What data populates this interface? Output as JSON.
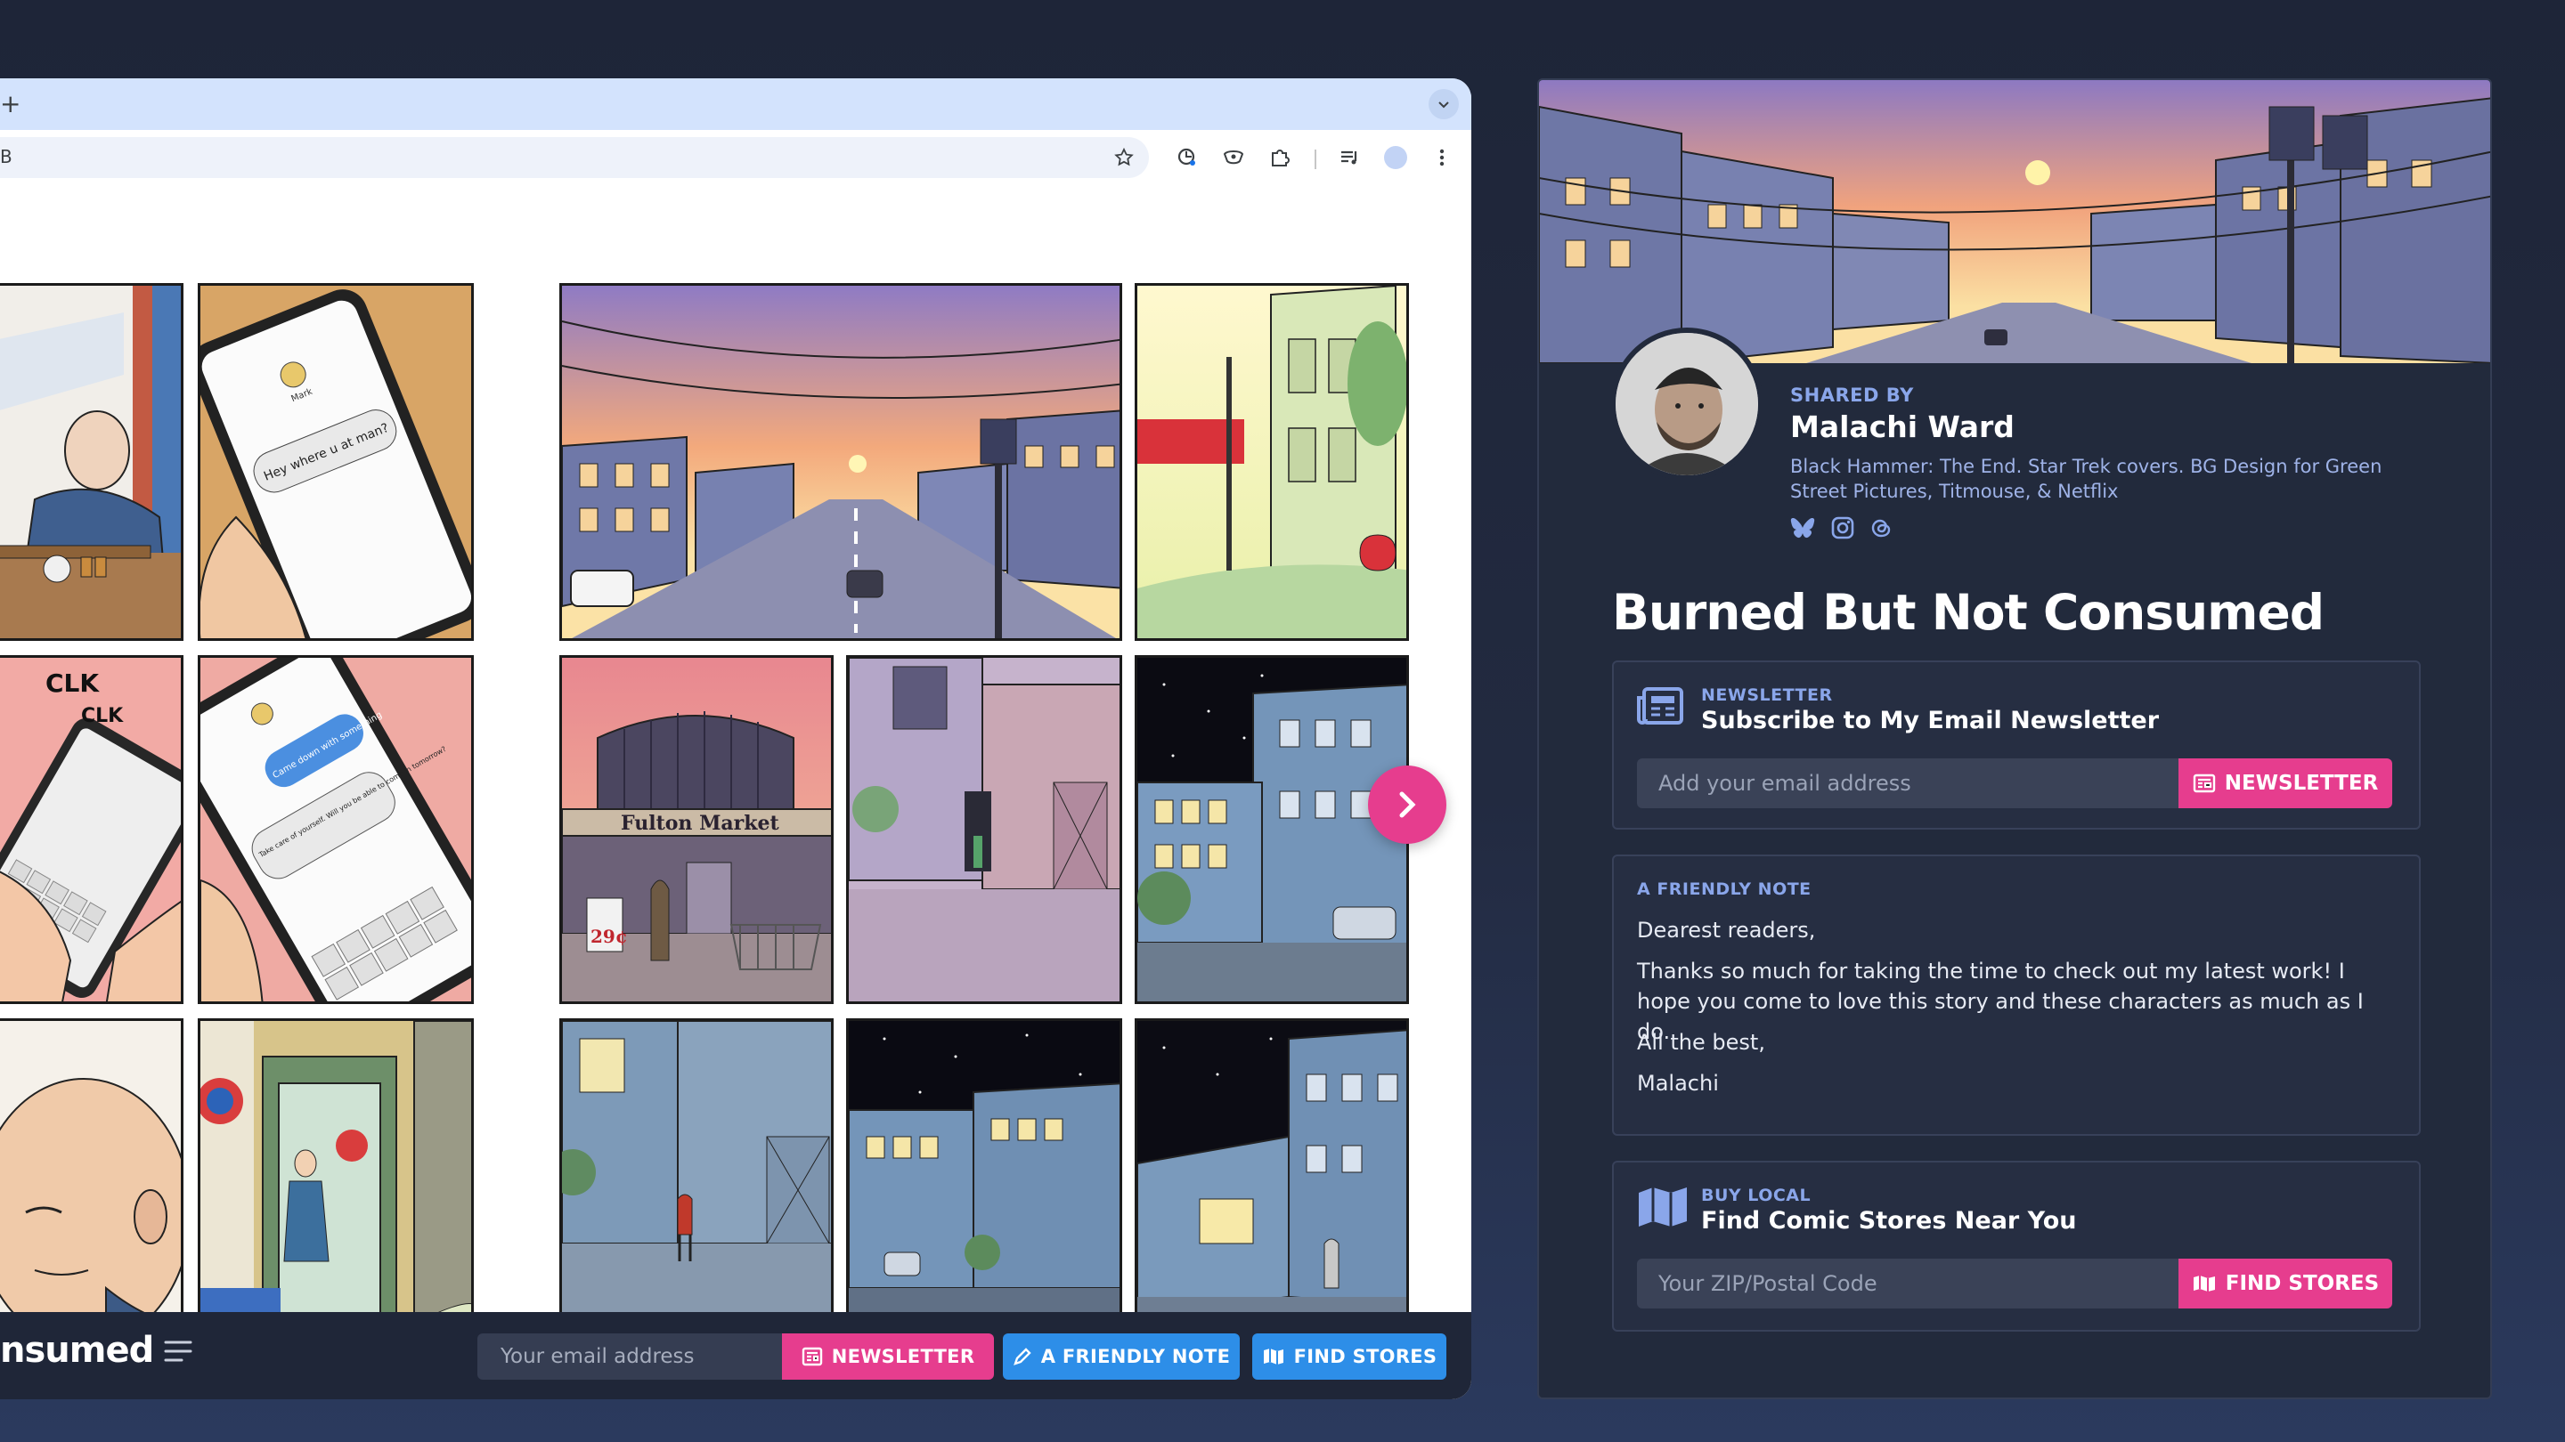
{
  "browser": {
    "new_tab_symbol": "+",
    "url_fragment": "B",
    "toolbar_icons": [
      "star-icon",
      "lens-icon",
      "eye-extension-icon",
      "puzzle-extension-icon",
      "media-queue-icon",
      "profile-avatar-icon",
      "more-vertical-icon"
    ]
  },
  "comic": {
    "sign_fulton": "Fulton Market",
    "price_tag": "29¢",
    "sfx": [
      "CLK",
      "CLK"
    ],
    "text_bubble_1": "Hey where u at man?",
    "text_bubble_2": "Came down with something",
    "text_bubble_3": "Take care of yourself. Will you be able to come in tomorrow?",
    "contact_name": "Mark"
  },
  "viewer_footer": {
    "title_fragment": "nsumed",
    "email_placeholder": "Your email address",
    "newsletter_label": "NEWSLETTER",
    "friendly_note_label": "A FRIENDLY NOTE",
    "find_stores_label": "FIND STORES"
  },
  "share_card": {
    "shared_by_label": "SHARED BY",
    "author_name": "Malachi Ward",
    "author_bio": "Black Hammer: The End. Star Trek covers. BG Design for Green Street Pictures, Titmouse, & Netflix",
    "socials": [
      "bluesky-icon",
      "instagram-icon",
      "threads-icon"
    ],
    "title": "Burned But Not Consumed",
    "newsletter": {
      "kicker": "NEWSLETTER",
      "title": "Subscribe to My Email Newsletter",
      "placeholder": "Add your email address",
      "button": "NEWSLETTER"
    },
    "note": {
      "kicker": "A FRIENDLY NOTE",
      "greeting": "Dearest readers,",
      "body": "Thanks so much for taking the time to check out my latest work! I hope you come to love this story and these characters as much as I do.",
      "closing": "All the best,",
      "signature": "Malachi"
    },
    "stores": {
      "kicker": "BUY LOCAL",
      "title": "Find Comic Stores Near You",
      "placeholder": "Your ZIP/Postal Code",
      "button": "FIND STORES"
    }
  },
  "colors": {
    "accent_pink": "#e63d8e",
    "accent_blue": "#2d8ee8",
    "card_bg": "#222a3c",
    "label_blue": "#8aa6ea"
  }
}
